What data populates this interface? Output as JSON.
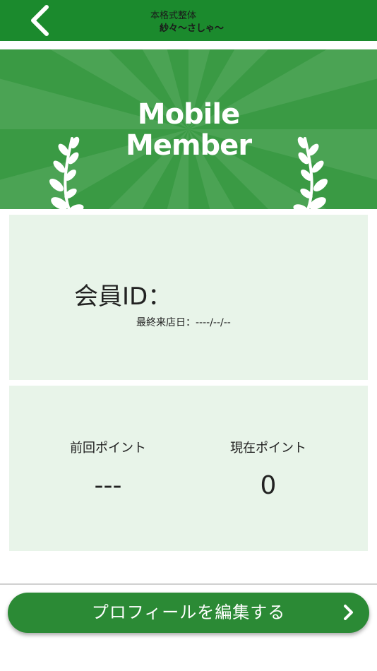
{
  "header": {
    "shop_name_line1": "本格式整体",
    "shop_name_line2": "紗々〜さしゃ〜",
    "back_icon": "chevron-left-icon",
    "background_color": "#1b8a2d"
  },
  "banner": {
    "title_line1": "Mobile",
    "title_line2": "Member",
    "decoration_icon": "laurel-branch-icon",
    "background_color": "#3a9a44"
  },
  "member_card": {
    "id_label": "会員ID：",
    "last_visit": "最終来店日：----/--/--",
    "background_color": "#e8f4e9"
  },
  "points_card": {
    "previous_label": "前回ポイント",
    "previous_value": "---",
    "current_label": "現在ポイント",
    "current_value": "0"
  },
  "footer": {
    "edit_profile_label": "プロフィールを編集する",
    "chevron_icon": "chevron-right-icon",
    "button_color": "#2b8a35"
  }
}
